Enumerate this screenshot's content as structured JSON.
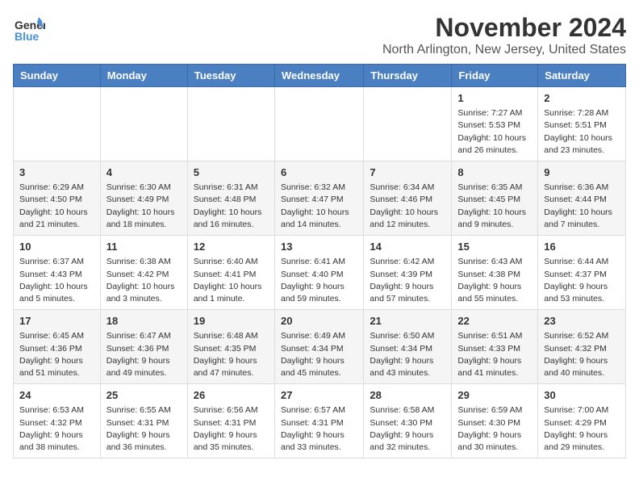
{
  "logo": {
    "general": "General",
    "blue": "Blue"
  },
  "title": "November 2024",
  "location": "North Arlington, New Jersey, United States",
  "weekdays": [
    "Sunday",
    "Monday",
    "Tuesday",
    "Wednesday",
    "Thursday",
    "Friday",
    "Saturday"
  ],
  "weeks": [
    [
      {
        "day": "",
        "info": ""
      },
      {
        "day": "",
        "info": ""
      },
      {
        "day": "",
        "info": ""
      },
      {
        "day": "",
        "info": ""
      },
      {
        "day": "",
        "info": ""
      },
      {
        "day": "1",
        "info": "Sunrise: 7:27 AM\nSunset: 5:53 PM\nDaylight: 10 hours and 26 minutes."
      },
      {
        "day": "2",
        "info": "Sunrise: 7:28 AM\nSunset: 5:51 PM\nDaylight: 10 hours and 23 minutes."
      }
    ],
    [
      {
        "day": "3",
        "info": "Sunrise: 6:29 AM\nSunset: 4:50 PM\nDaylight: 10 hours and 21 minutes."
      },
      {
        "day": "4",
        "info": "Sunrise: 6:30 AM\nSunset: 4:49 PM\nDaylight: 10 hours and 18 minutes."
      },
      {
        "day": "5",
        "info": "Sunrise: 6:31 AM\nSunset: 4:48 PM\nDaylight: 10 hours and 16 minutes."
      },
      {
        "day": "6",
        "info": "Sunrise: 6:32 AM\nSunset: 4:47 PM\nDaylight: 10 hours and 14 minutes."
      },
      {
        "day": "7",
        "info": "Sunrise: 6:34 AM\nSunset: 4:46 PM\nDaylight: 10 hours and 12 minutes."
      },
      {
        "day": "8",
        "info": "Sunrise: 6:35 AM\nSunset: 4:45 PM\nDaylight: 10 hours and 9 minutes."
      },
      {
        "day": "9",
        "info": "Sunrise: 6:36 AM\nSunset: 4:44 PM\nDaylight: 10 hours and 7 minutes."
      }
    ],
    [
      {
        "day": "10",
        "info": "Sunrise: 6:37 AM\nSunset: 4:43 PM\nDaylight: 10 hours and 5 minutes."
      },
      {
        "day": "11",
        "info": "Sunrise: 6:38 AM\nSunset: 4:42 PM\nDaylight: 10 hours and 3 minutes."
      },
      {
        "day": "12",
        "info": "Sunrise: 6:40 AM\nSunset: 4:41 PM\nDaylight: 10 hours and 1 minute."
      },
      {
        "day": "13",
        "info": "Sunrise: 6:41 AM\nSunset: 4:40 PM\nDaylight: 9 hours and 59 minutes."
      },
      {
        "day": "14",
        "info": "Sunrise: 6:42 AM\nSunset: 4:39 PM\nDaylight: 9 hours and 57 minutes."
      },
      {
        "day": "15",
        "info": "Sunrise: 6:43 AM\nSunset: 4:38 PM\nDaylight: 9 hours and 55 minutes."
      },
      {
        "day": "16",
        "info": "Sunrise: 6:44 AM\nSunset: 4:37 PM\nDaylight: 9 hours and 53 minutes."
      }
    ],
    [
      {
        "day": "17",
        "info": "Sunrise: 6:45 AM\nSunset: 4:36 PM\nDaylight: 9 hours and 51 minutes."
      },
      {
        "day": "18",
        "info": "Sunrise: 6:47 AM\nSunset: 4:36 PM\nDaylight: 9 hours and 49 minutes."
      },
      {
        "day": "19",
        "info": "Sunrise: 6:48 AM\nSunset: 4:35 PM\nDaylight: 9 hours and 47 minutes."
      },
      {
        "day": "20",
        "info": "Sunrise: 6:49 AM\nSunset: 4:34 PM\nDaylight: 9 hours and 45 minutes."
      },
      {
        "day": "21",
        "info": "Sunrise: 6:50 AM\nSunset: 4:34 PM\nDaylight: 9 hours and 43 minutes."
      },
      {
        "day": "22",
        "info": "Sunrise: 6:51 AM\nSunset: 4:33 PM\nDaylight: 9 hours and 41 minutes."
      },
      {
        "day": "23",
        "info": "Sunrise: 6:52 AM\nSunset: 4:32 PM\nDaylight: 9 hours and 40 minutes."
      }
    ],
    [
      {
        "day": "24",
        "info": "Sunrise: 6:53 AM\nSunset: 4:32 PM\nDaylight: 9 hours and 38 minutes."
      },
      {
        "day": "25",
        "info": "Sunrise: 6:55 AM\nSunset: 4:31 PM\nDaylight: 9 hours and 36 minutes."
      },
      {
        "day": "26",
        "info": "Sunrise: 6:56 AM\nSunset: 4:31 PM\nDaylight: 9 hours and 35 minutes."
      },
      {
        "day": "27",
        "info": "Sunrise: 6:57 AM\nSunset: 4:31 PM\nDaylight: 9 hours and 33 minutes."
      },
      {
        "day": "28",
        "info": "Sunrise: 6:58 AM\nSunset: 4:30 PM\nDaylight: 9 hours and 32 minutes."
      },
      {
        "day": "29",
        "info": "Sunrise: 6:59 AM\nSunset: 4:30 PM\nDaylight: 9 hours and 30 minutes."
      },
      {
        "day": "30",
        "info": "Sunrise: 7:00 AM\nSunset: 4:29 PM\nDaylight: 9 hours and 29 minutes."
      }
    ]
  ]
}
